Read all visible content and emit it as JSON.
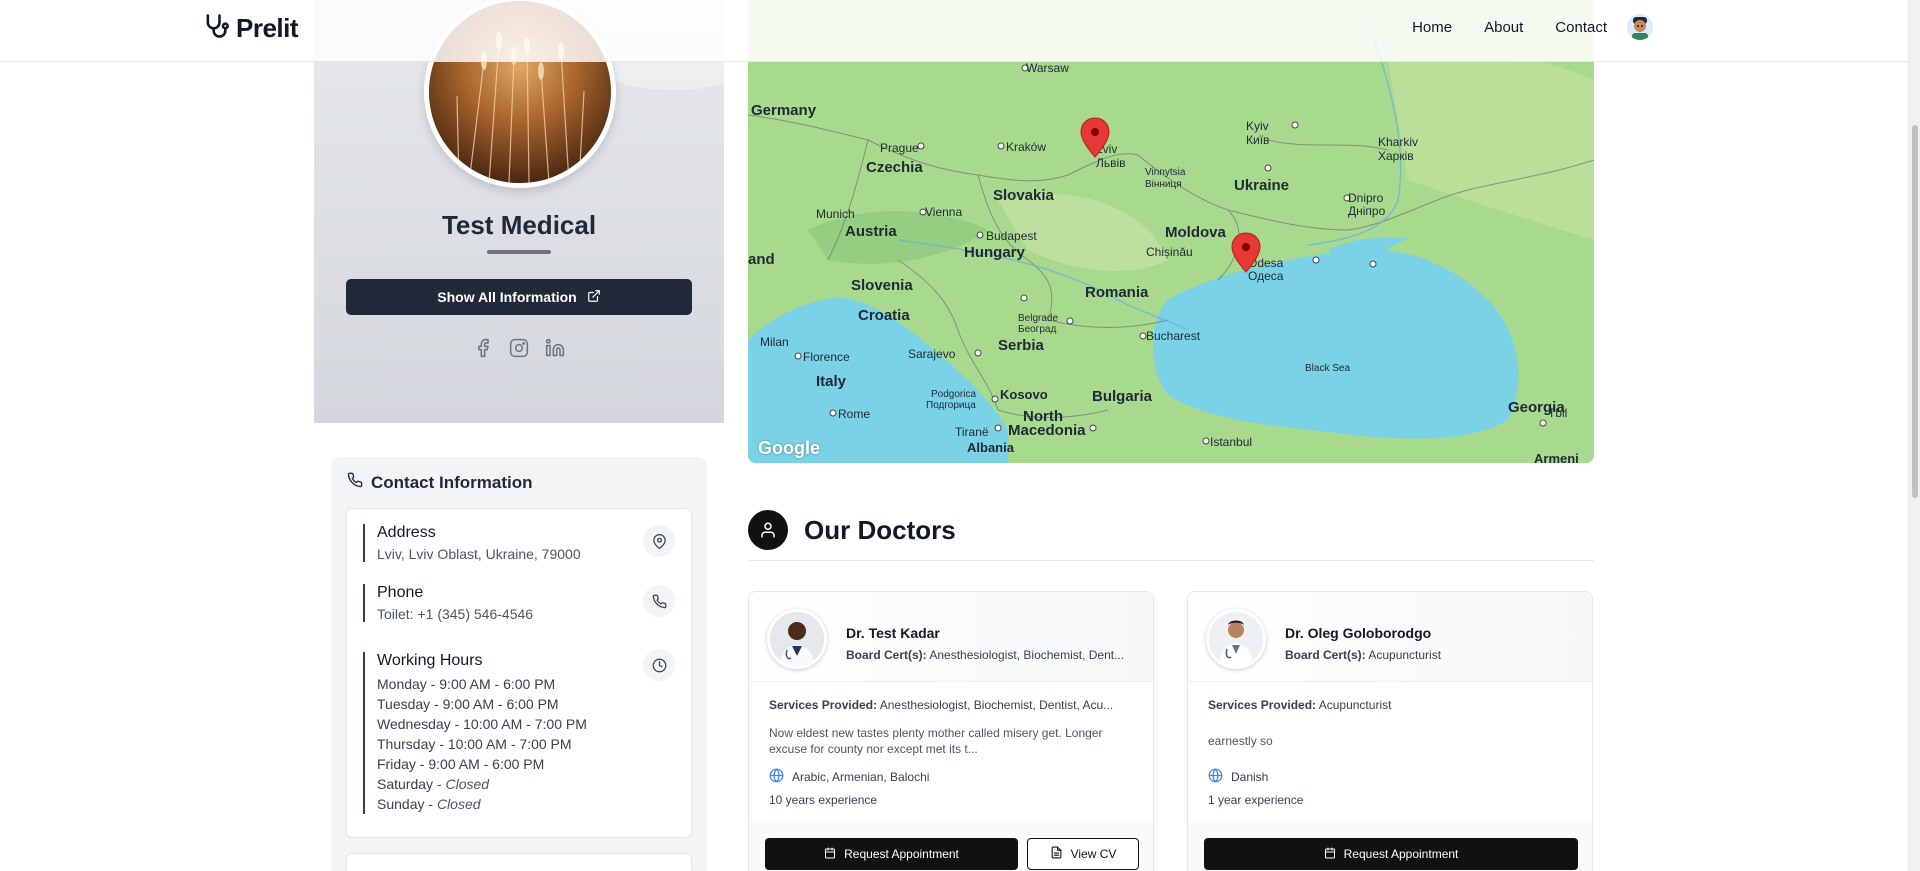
{
  "header": {
    "brand": "Prelit",
    "nav": [
      "Home",
      "About",
      "Contact"
    ]
  },
  "profile": {
    "name": "Test Medical",
    "show_all_label": "Show All Information",
    "socials": [
      "facebook-icon",
      "instagram-icon",
      "linkedin-icon"
    ]
  },
  "contact": {
    "title": "Contact Information",
    "address_label": "Address",
    "address_value": "Lviv, Lviv Oblast, Ukraine, 79000",
    "phone_label": "Phone",
    "phone_value": "Toilet: +1 (345) 546-4546",
    "hours_label": "Working Hours",
    "hours": [
      {
        "day": "Monday",
        "time": "9:00 AM - 6:00 PM"
      },
      {
        "day": "Tuesday",
        "time": "9:00 AM - 6:00 PM"
      },
      {
        "day": "Wednesday",
        "time": "10:00 AM - 7:00 PM"
      },
      {
        "day": "Thursday",
        "time": "10:00 AM - 7:00 PM"
      },
      {
        "day": "Friday",
        "time": "9:00 AM - 6:00 PM"
      },
      {
        "day": "Saturday",
        "time": "Closed"
      },
      {
        "day": "Sunday",
        "time": "Closed"
      }
    ]
  },
  "map": {
    "google_label": "Google",
    "places": {
      "warsaw": "Warsaw",
      "germany": "Germany",
      "prague": "Prague",
      "czechia": "Czechia",
      "krakow": "Kraków",
      "lviv": "Lviv",
      "lviv_uk": "Львів",
      "kyiv": "Kyiv",
      "kyiv_uk": "Київ",
      "kharkiv": "Kharkiv",
      "kharkiv_uk": "Харків",
      "vinnytsia": "Vinnytsia",
      "vinnytsia_uk": "Вінниця",
      "ukraine": "Ukraine",
      "slovakia": "Slovakia",
      "munich": "Munich",
      "vienna": "Vienna",
      "austria": "Austria",
      "budapest": "Budapest",
      "hungary": "Hungary",
      "moldova": "Moldova",
      "chisinau": "Chișinău",
      "odesa": "Odesa",
      "odesa_uk": "Одеса",
      "dnipro": "Dnipro",
      "dnipro_uk": "Дніпро",
      "land": "and",
      "slovenia": "Slovenia",
      "croatia": "Croatia",
      "romania": "Romania",
      "belgrade": "Belgrade",
      "belgrade_sr": "Београд",
      "milan": "Milan",
      "serbia": "Serbia",
      "bucharest": "Bucharest",
      "florence": "Florence",
      "sarajevo": "Sarajevo",
      "italy": "Italy",
      "black_sea": "Black Sea",
      "podgorica": "Podgorica",
      "podgorica_sr": "Подгорица",
      "kosovo": "Kosovo",
      "bulgaria": "Bulgaria",
      "georgia": "Georgia",
      "tbilisi": "Tbil",
      "rome": "Rome",
      "north": "North",
      "macedonia": "Macedonia",
      "tirane": "Tiranë",
      "albania": "Albania",
      "istanbul": "Istanbul",
      "armeni": "Armeni"
    }
  },
  "doctors": {
    "title": "Our Doctors",
    "list": [
      {
        "name": "Dr. Test Kadar",
        "cert_label": "Board Cert(s):",
        "cert_value": "Anesthesiologist, Biochemist, Dent...",
        "services_label": "Services Provided:",
        "services_value": "Anesthesiologist, Biochemist, Dentist, Acu...",
        "description": "Now eldest new tastes plenty mother called misery get. Longer excuse for county nor except met its t...",
        "languages": "Arabic, Armenian, Balochi",
        "experience": "10 years experience",
        "request_label": "Request Appointment",
        "cv_label": "View CV"
      },
      {
        "name": "Dr. Oleg Goloborodgo",
        "cert_label": "Board Cert(s):",
        "cert_value": "Acupuncturist",
        "services_label": "Services Provided:",
        "services_value": "Acupuncturist",
        "description": "earnestly so",
        "languages": "Danish",
        "experience": "1 year experience",
        "request_label": "Request Appointment"
      }
    ]
  },
  "colors": {
    "primary_dark": "#1f2937",
    "button_black": "#111111",
    "marker_red": "#e53935",
    "map_land": "#aadc8f",
    "map_water": "#76d0e3"
  }
}
